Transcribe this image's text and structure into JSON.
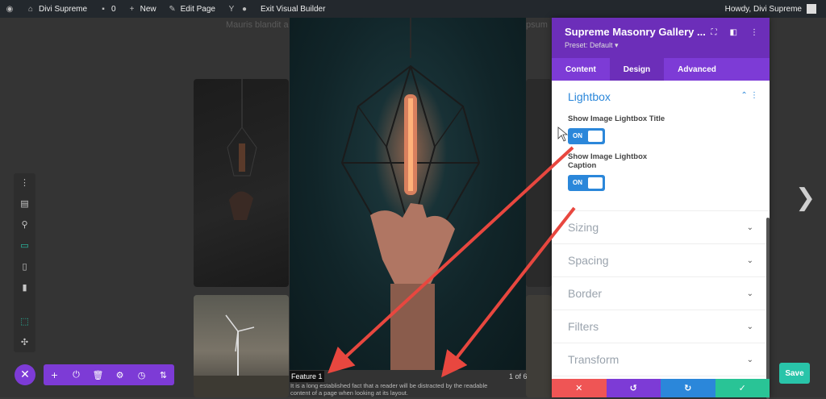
{
  "adminbar": {
    "site_name": "Divi Supreme",
    "comments_count": "0",
    "new_label": "New",
    "edit_page_label": "Edit Page",
    "exit_builder_label": "Exit Visual Builder",
    "howdy": "Howdy, Divi Supreme"
  },
  "page": {
    "bg_text_left": "Mauris blandit a",
    "bg_text_right": "psum"
  },
  "lightbox": {
    "title": "Feature 1",
    "caption": "It is a long established fact that a reader will be distracted by the readable content of a page when looking at its layout.",
    "counter": "1 of 6",
    "next_icon": "chevron-right-icon"
  },
  "settings_panel": {
    "title": "Supreme Masonry Gallery ...",
    "preset": "Preset: Default",
    "tabs": [
      {
        "label": "Content",
        "active": false
      },
      {
        "label": "Design",
        "active": true
      },
      {
        "label": "Advanced",
        "active": false
      }
    ],
    "open_section": {
      "title": "Lightbox",
      "options": [
        {
          "label": "Show Image Lightbox Title",
          "value": "ON"
        },
        {
          "label": "Show Image Lightbox Caption",
          "value": "ON"
        }
      ]
    },
    "collapsed_sections": [
      "Sizing",
      "Spacing",
      "Border",
      "Filters",
      "Transform"
    ],
    "footer_colors": {
      "discard": "#ef5555",
      "undo": "#7d3bd6",
      "redo": "#2b87da",
      "save": "#29c496"
    }
  },
  "builder": {
    "save_label": "Save",
    "accent": "#7d3bd6",
    "save_color": "#29c4a9"
  },
  "annotation": {
    "arrow_color": "#e8473f"
  }
}
